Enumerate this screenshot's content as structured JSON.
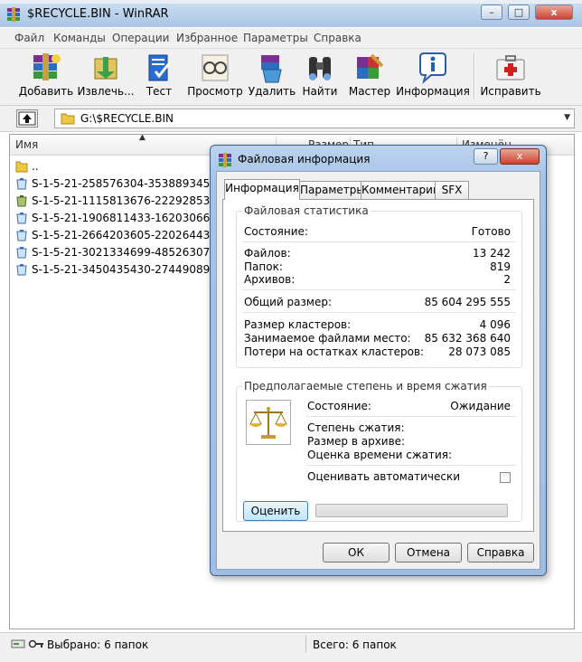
{
  "window": {
    "title": "$RECYCLE.BIN - WinRAR",
    "controls": {
      "minimize": "–",
      "maximize": "□",
      "close": "x"
    }
  },
  "menu": [
    "Файл",
    "Команды",
    "Операции",
    "Избранное",
    "Параметры",
    "Справка"
  ],
  "toolbar": [
    {
      "label": "Добавить",
      "icon": "archive-add-icon"
    },
    {
      "label": "Извлечь...",
      "icon": "extract-icon"
    },
    {
      "label": "Тест",
      "icon": "test-icon"
    },
    {
      "label": "Просмотр",
      "icon": "view-glasses-icon"
    },
    {
      "label": "Удалить",
      "icon": "delete-recycle-icon"
    },
    {
      "label": "Найти",
      "icon": "find-binoculars-icon"
    },
    {
      "label": "Мастер",
      "icon": "wizard-icon"
    },
    {
      "label": "Информация",
      "icon": "info-icon"
    },
    {
      "label": "Исправить",
      "icon": "repair-firstaid-icon"
    }
  ],
  "address": {
    "path": "G:\\$RECYCLE.BIN"
  },
  "columns": [
    "Имя",
    "Размер",
    "Тип",
    "Изменён"
  ],
  "files": [
    "..",
    "S-1-5-21-258576304-353889345-260000",
    "S-1-5-21-1115813676-2229285331-232",
    "S-1-5-21-1906811433-1620306669-260",
    "S-1-5-21-2664203605-2202644353-289",
    "S-1-5-21-3021334699-485263077-2740",
    "S-1-5-21-3450435430-2744908958-399"
  ],
  "status": {
    "selected": "Выбрано: 6 папок",
    "total": "Всего: 6 папок"
  },
  "dialog": {
    "title": "Файловая информация",
    "help_button": "?",
    "close_button": "x",
    "tabs": [
      "Информация",
      "Параметры",
      "Комментарий",
      "SFX"
    ],
    "stats": {
      "title": "Файловая статистика",
      "state_label": "Состояние:",
      "state_value": "Готово",
      "files_label": "Файлов:",
      "files_value": "13 242",
      "folders_label": "Папок:",
      "folders_value": "819",
      "archives_label": "Архивов:",
      "archives_value": "2",
      "total_size_label": "Общий размер:",
      "total_size_value": "85 604 295 555",
      "cluster_label": "Размер кластеров:",
      "cluster_value": "4 096",
      "occupied_label": "Занимаемое файлами место:",
      "occupied_value": "85 632 368 640",
      "loss_label": "Потери на остатках кластеров:",
      "loss_value": "28 073 085"
    },
    "compression": {
      "title": "Предполагаемые степень и время сжатия",
      "state_label": "Состояние:",
      "state_value": "Ожидание",
      "ratio_label": "Степень сжатия:",
      "archive_size_label": "Размер в архиве:",
      "time_label": "Оценка времени сжатия:",
      "auto_label": "Оценивать автоматически",
      "auto_checked": false,
      "estimate_button": "Оценить",
      "progress": 0
    },
    "buttons": {
      "ok": "ОК",
      "cancel": "Отмена",
      "help": "Справка"
    }
  }
}
